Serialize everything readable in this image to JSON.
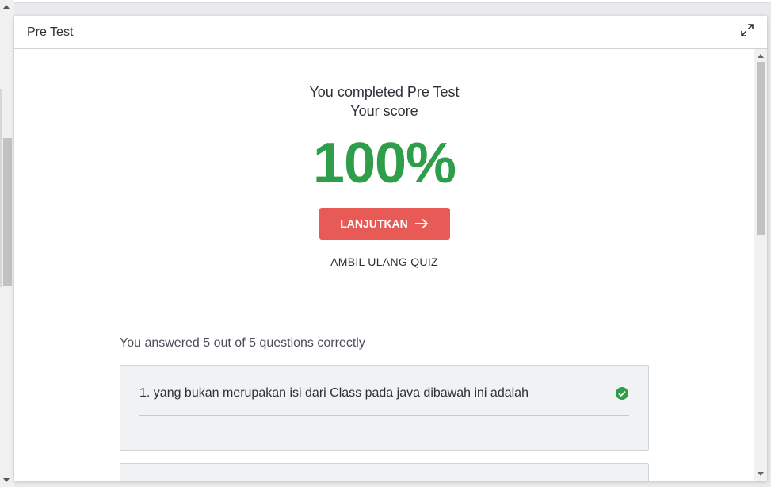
{
  "modal": {
    "title": "Pre Test"
  },
  "result": {
    "completed_text": "You completed Pre Test",
    "score_label": "Your score",
    "score_value": "100%",
    "continue_label": "LANJUTKAN",
    "retake_label": "AMBIL ULANG QUIZ"
  },
  "summary": {
    "text": "You answered 5 out of 5 questions correctly",
    "answered": 5,
    "total": 5
  },
  "questions": [
    {
      "text": "1. yang bukan merupakan isi dari Class pada java dibawah ini adalah",
      "status": "correct"
    }
  ],
  "colors": {
    "score": "#2e9e4a",
    "continue_button": "#e85a56",
    "correct_icon": "#2e9e4a"
  },
  "icons": {
    "expand": "expand-icon",
    "continue_arrow": "arrow-right-icon",
    "correct": "check-circle-icon"
  }
}
